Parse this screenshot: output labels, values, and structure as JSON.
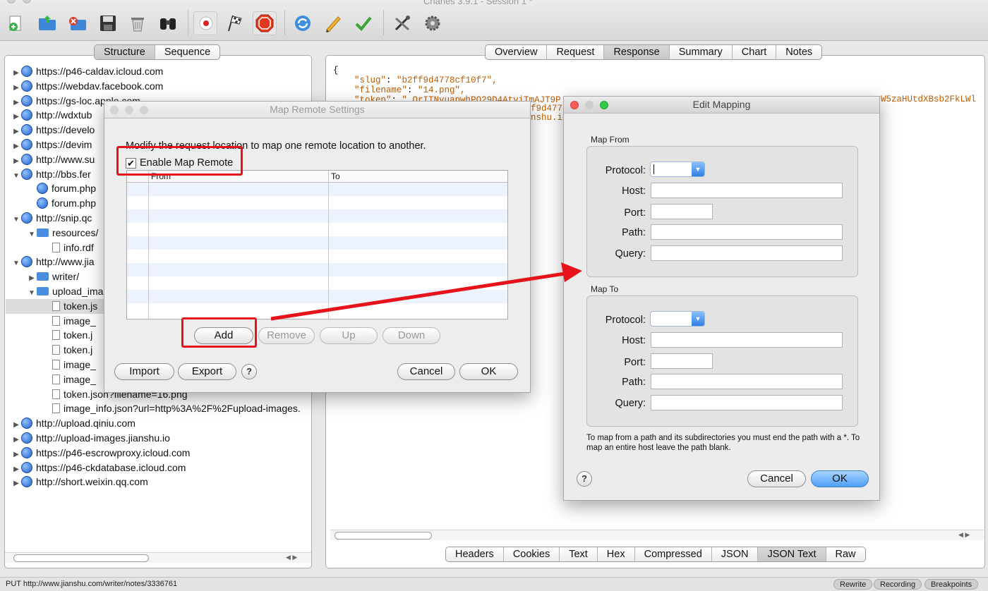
{
  "window": {
    "title": "Charles 3.9.1 - Session 1 *"
  },
  "toolbar": {
    "icons": [
      "new-session-icon",
      "open-icon",
      "close-icon",
      "save-icon",
      "trash-icon",
      "binoculars-icon",
      "record-icon",
      "throttle-flag-icon",
      "stop-icon",
      "refresh-icon",
      "pencil-icon",
      "checkmark-icon",
      "tools-icon",
      "gear-icon"
    ]
  },
  "left_tabs": [
    "Structure",
    "Sequence"
  ],
  "right_tabs": [
    "Overview",
    "Request",
    "Response",
    "Summary",
    "Chart",
    "Notes"
  ],
  "bottom_tabs": [
    "Headers",
    "Cookies",
    "Text",
    "Hex",
    "Compressed",
    "JSON",
    "JSON Text",
    "Raw"
  ],
  "tree": [
    {
      "label": "https://p46-caldav.icloud.com",
      "type": "host",
      "level": 0,
      "open": false
    },
    {
      "label": "https://webdav.facebook.com",
      "type": "host",
      "level": 0,
      "open": false
    },
    {
      "label": "https://gs-loc.apple.com",
      "type": "host",
      "level": 0,
      "open": false
    },
    {
      "label": "http://wdxtub",
      "type": "host",
      "level": 0,
      "open": false
    },
    {
      "label": "https://develo",
      "type": "host",
      "level": 0,
      "open": false
    },
    {
      "label": "https://devim",
      "type": "host",
      "level": 0,
      "open": false
    },
    {
      "label": "http://www.su",
      "type": "host",
      "level": 0,
      "open": false
    },
    {
      "label": "http://bbs.fer",
      "type": "host",
      "level": 0,
      "open": true
    },
    {
      "label": "forum.php",
      "type": "globe",
      "level": 1
    },
    {
      "label": "forum.php",
      "type": "globe",
      "level": 1
    },
    {
      "label": "http://snip.qc",
      "type": "host",
      "level": 0,
      "open": true
    },
    {
      "label": "resources/",
      "type": "folder",
      "level": 1,
      "open": true
    },
    {
      "label": "info.rdf",
      "type": "file",
      "level": 2
    },
    {
      "label": "http://www.jia",
      "type": "host",
      "level": 0,
      "open": true
    },
    {
      "label": "writer/",
      "type": "folder",
      "level": 1,
      "open": false
    },
    {
      "label": "upload_ima",
      "type": "folder",
      "level": 1,
      "open": true
    },
    {
      "label": "token.js",
      "type": "file",
      "level": 2,
      "selected": true
    },
    {
      "label": "image_",
      "type": "file",
      "level": 2
    },
    {
      "label": "token.j",
      "type": "file",
      "level": 2
    },
    {
      "label": "token.j",
      "type": "file",
      "level": 2
    },
    {
      "label": "image_",
      "type": "file",
      "level": 2
    },
    {
      "label": "image_",
      "type": "file",
      "level": 2
    },
    {
      "label": "token.json?filename=16.png",
      "type": "file",
      "level": 2
    },
    {
      "label": "image_info.json?url=http%3A%2F%2Fupload-images.",
      "type": "file",
      "level": 2
    },
    {
      "label": "http://upload.qiniu.com",
      "type": "host",
      "level": 0,
      "open": false
    },
    {
      "label": "http://upload-images.jianshu.io",
      "type": "host",
      "level": 0,
      "open": false
    },
    {
      "label": "https://p46-escrowproxy.icloud.com",
      "type": "host",
      "level": 0,
      "open": false
    },
    {
      "label": "https://p46-ckdatabase.icloud.com",
      "type": "host",
      "level": 0,
      "open": false
    },
    {
      "label": "http://short.weixin.qq.com",
      "type": "host",
      "level": 0,
      "open": false
    }
  ],
  "response_text": {
    "brace": "{",
    "slug_key": "\"slug\"",
    "slug_val": "\"b2ff9d4778cf10f7\",",
    "filename_key": "\"filename\"",
    "filename_val": "\"14.png\",",
    "token_key": "\"token\"",
    "token_val": "\" OrITNvuapwhPO29D4AtyiTmAJT9P",
    "frag1": "W5zaHUtdXBsb2FkLWl",
    "frag2": "f9d4778",
    "frag3": "nshu.ic"
  },
  "status": {
    "text": "PUT http://www.jianshu.com/writer/notes/3336761",
    "buttons": [
      "Rewrite",
      "Recording",
      "Breakpoints"
    ]
  },
  "map_remote": {
    "title": "Map Remote Settings",
    "description": "Modify the request location to map one remote location to another.",
    "enable_label": "Enable Map Remote",
    "enable_checked": true,
    "columns": [
      "From",
      "To"
    ],
    "buttons": {
      "add": "Add",
      "remove": "Remove",
      "up": "Up",
      "down": "Down",
      "import": "Import",
      "export": "Export",
      "help": "?",
      "cancel": "Cancel",
      "ok": "OK"
    }
  },
  "edit_mapping": {
    "title": "Edit Mapping",
    "from_label": "Map From",
    "to_label": "Map To",
    "fields": [
      "Protocol:",
      "Host:",
      "Port:",
      "Path:",
      "Query:"
    ],
    "from_values": {
      "protocol": "",
      "host": "",
      "port": "",
      "path": "",
      "query": ""
    },
    "to_values": {
      "protocol": "",
      "host": "",
      "port": "",
      "path": "",
      "query": ""
    },
    "hint": "To map from a path and its subdirectories you must end the path with a *. To map an entire host leave the path blank.",
    "buttons": {
      "help": "?",
      "cancel": "Cancel",
      "ok": "OK"
    }
  },
  "colors": {
    "annotation": "#e8121b",
    "stripe": "#edf3fe",
    "ok_blue": "#4f9ef7"
  }
}
